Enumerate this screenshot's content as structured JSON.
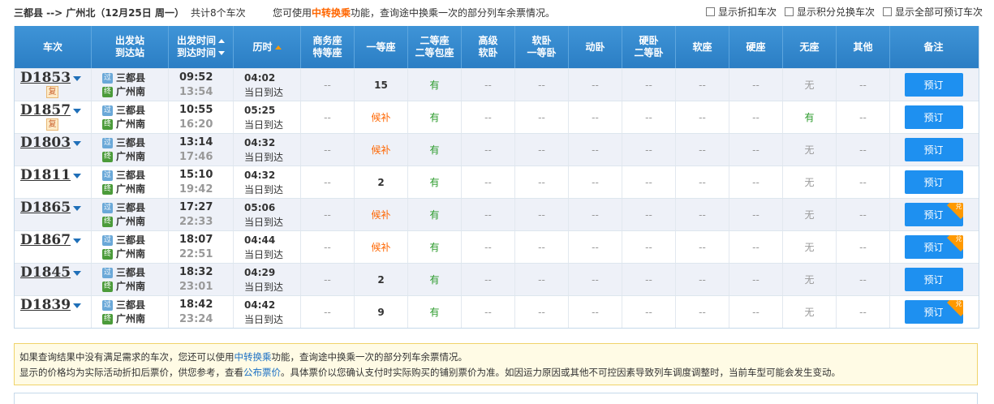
{
  "header": {
    "route": "三都县 --> 广州北（12月25日 周一）",
    "count": "共计8个车次",
    "tip_prefix": "您可使用",
    "tip_link": "中转换乘",
    "tip_suffix": "功能，查询途中换乘一次的部分列车余票情况。",
    "options": [
      "显示折扣车次",
      "显示积分兑换车次",
      "显示全部可预订车次"
    ]
  },
  "columns": {
    "train": "车次",
    "station_top": "出发站",
    "station_bottom": "到达站",
    "time_top": "出发时间",
    "time_bottom": "到达时间",
    "duration": "历时",
    "business_top": "商务座",
    "business_bottom": "特等座",
    "first": "一等座",
    "second_top": "二等座",
    "second_bottom": "二等包座",
    "adv_soft_top": "高级",
    "adv_soft_bottom": "软卧",
    "soft_sleeper_top": "软卧",
    "soft_sleeper_bottom": "一等卧",
    "emu_sleeper": "动卧",
    "hard_sleeper_top": "硬卧",
    "hard_sleeper_bottom": "二等卧",
    "soft_seat": "软座",
    "hard_seat": "硬座",
    "no_seat": "无座",
    "other": "其他",
    "remark": "备注"
  },
  "rows": [
    {
      "train": "D1853",
      "fu": "复",
      "from_icon": "过",
      "from": "三都县",
      "to_icon": "终",
      "to": "广州南",
      "dep": "09:52",
      "arr": "13:54",
      "dur": "04:02",
      "day": "当日到达",
      "business": "--",
      "first": "15",
      "second": "有",
      "adv_soft": "--",
      "soft_sleeper": "--",
      "emu_sleeper": "--",
      "hard_sleeper": "--",
      "soft_seat": "--",
      "hard_seat": "--",
      "no_seat": "无",
      "other": "--",
      "book": "预订",
      "exchange": ""
    },
    {
      "train": "D1857",
      "fu": "复",
      "from_icon": "过",
      "from": "三都县",
      "to_icon": "终",
      "to": "广州南",
      "dep": "10:55",
      "arr": "16:20",
      "dur": "05:25",
      "day": "当日到达",
      "business": "--",
      "first": "候补",
      "second": "有",
      "adv_soft": "--",
      "soft_sleeper": "--",
      "emu_sleeper": "--",
      "hard_sleeper": "--",
      "soft_seat": "--",
      "hard_seat": "--",
      "no_seat": "有",
      "other": "--",
      "book": "预订",
      "exchange": ""
    },
    {
      "train": "D1803",
      "fu": "",
      "from_icon": "过",
      "from": "三都县",
      "to_icon": "终",
      "to": "广州南",
      "dep": "13:14",
      "arr": "17:46",
      "dur": "04:32",
      "day": "当日到达",
      "business": "--",
      "first": "候补",
      "second": "有",
      "adv_soft": "--",
      "soft_sleeper": "--",
      "emu_sleeper": "--",
      "hard_sleeper": "--",
      "soft_seat": "--",
      "hard_seat": "--",
      "no_seat": "无",
      "other": "--",
      "book": "预订",
      "exchange": ""
    },
    {
      "train": "D1811",
      "fu": "",
      "from_icon": "过",
      "from": "三都县",
      "to_icon": "终",
      "to": "广州南",
      "dep": "15:10",
      "arr": "19:42",
      "dur": "04:32",
      "day": "当日到达",
      "business": "--",
      "first": "2",
      "second": "有",
      "adv_soft": "--",
      "soft_sleeper": "--",
      "emu_sleeper": "--",
      "hard_sleeper": "--",
      "soft_seat": "--",
      "hard_seat": "--",
      "no_seat": "无",
      "other": "--",
      "book": "预订",
      "exchange": ""
    },
    {
      "train": "D1865",
      "fu": "",
      "from_icon": "过",
      "from": "三都县",
      "to_icon": "终",
      "to": "广州南",
      "dep": "17:27",
      "arr": "22:33",
      "dur": "05:06",
      "day": "当日到达",
      "business": "--",
      "first": "候补",
      "second": "有",
      "adv_soft": "--",
      "soft_sleeper": "--",
      "emu_sleeper": "--",
      "hard_sleeper": "--",
      "soft_seat": "--",
      "hard_seat": "--",
      "no_seat": "无",
      "other": "--",
      "book": "预订",
      "exchange": "兑"
    },
    {
      "train": "D1867",
      "fu": "",
      "from_icon": "过",
      "from": "三都县",
      "to_icon": "终",
      "to": "广州南",
      "dep": "18:07",
      "arr": "22:51",
      "dur": "04:44",
      "day": "当日到达",
      "business": "--",
      "first": "候补",
      "second": "有",
      "adv_soft": "--",
      "soft_sleeper": "--",
      "emu_sleeper": "--",
      "hard_sleeper": "--",
      "soft_seat": "--",
      "hard_seat": "--",
      "no_seat": "无",
      "other": "--",
      "book": "预订",
      "exchange": "兑"
    },
    {
      "train": "D1845",
      "fu": "",
      "from_icon": "过",
      "from": "三都县",
      "to_icon": "终",
      "to": "广州南",
      "dep": "18:32",
      "arr": "23:01",
      "dur": "04:29",
      "day": "当日到达",
      "business": "--",
      "first": "2",
      "second": "有",
      "adv_soft": "--",
      "soft_sleeper": "--",
      "emu_sleeper": "--",
      "hard_sleeper": "--",
      "soft_seat": "--",
      "hard_seat": "--",
      "no_seat": "无",
      "other": "--",
      "book": "预订",
      "exchange": ""
    },
    {
      "train": "D1839",
      "fu": "",
      "from_icon": "过",
      "from": "三都县",
      "to_icon": "终",
      "to": "广州南",
      "dep": "18:42",
      "arr": "23:24",
      "dur": "04:42",
      "day": "当日到达",
      "business": "--",
      "first": "9",
      "second": "有",
      "adv_soft": "--",
      "soft_sleeper": "--",
      "emu_sleeper": "--",
      "hard_sleeper": "--",
      "soft_seat": "--",
      "hard_seat": "--",
      "no_seat": "无",
      "other": "--",
      "book": "预订",
      "exchange": "兑"
    }
  ],
  "notice": {
    "line1_prefix": "如果查询结果中没有满足需求的车次，您还可以使用",
    "line1_link": "中转换乘",
    "line1_suffix": "功能，查询途中换乘一次的部分列车余票情况。",
    "line2_prefix": "显示的价格均为实际活动折扣后票价，供您参考，查看",
    "line2_link": "公布票价",
    "line2_suffix": "。具体票价以您确认支付时实际购买的铺别票价为准。如因运力原因或其他不可控因素导致列车调度调整时，当前车型可能会发生变动。"
  },
  "colors": {
    "header_blue": "#2b7ec4",
    "book_button": "#1e90f0",
    "available_green": "#2a9a2a",
    "waitlist_orange": "#f60",
    "exchange_corner": "#f90"
  }
}
